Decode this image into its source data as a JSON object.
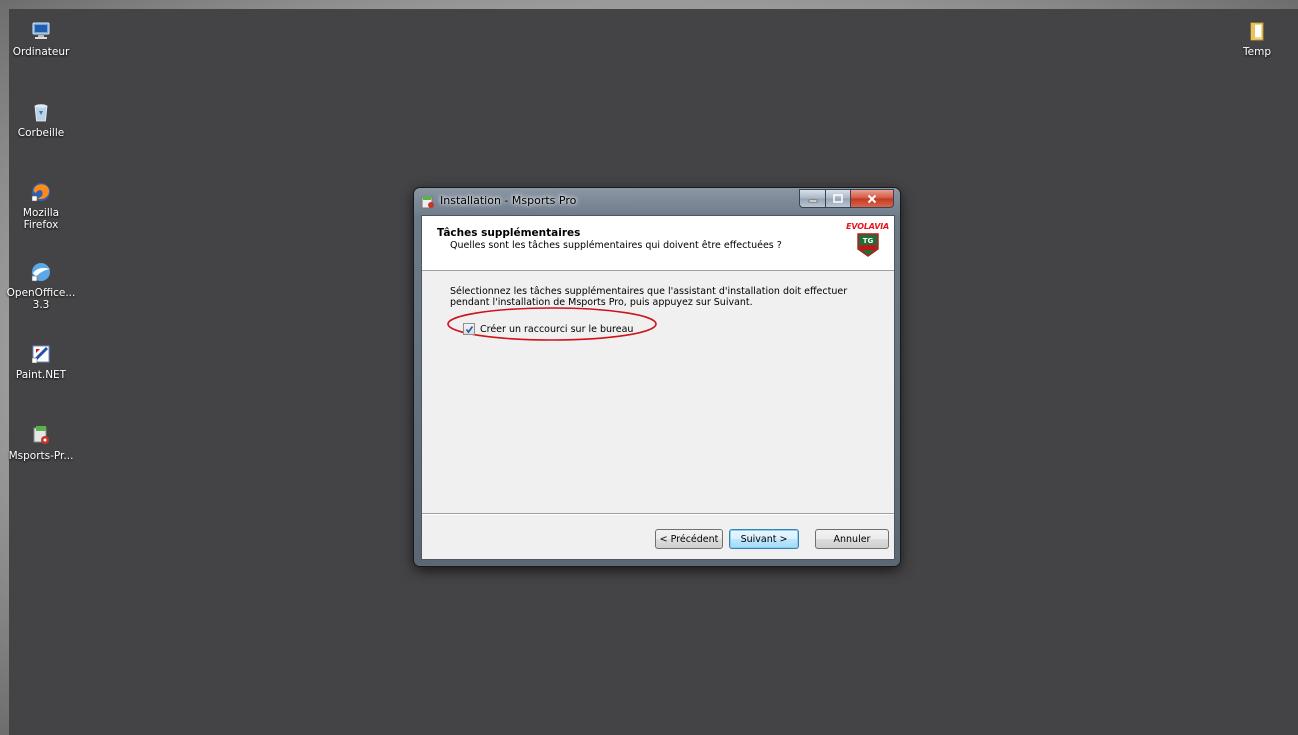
{
  "desktop": {
    "icons_left": [
      {
        "label": "Ordinateur",
        "icon": "computer-icon"
      },
      {
        "label": "Corbeille",
        "icon": "recycle-bin-icon"
      },
      {
        "label": "Mozilla\nFirefox",
        "icon": "firefox-icon"
      },
      {
        "label": "OpenOffice...\n3.3",
        "icon": "openoffice-icon"
      },
      {
        "label": "Paint.NET",
        "icon": "paintnet-icon"
      },
      {
        "label": "Msports-Pr...",
        "icon": "installer-icon"
      }
    ],
    "icon_right": {
      "label": "Temp",
      "icon": "folder-icon"
    }
  },
  "dialog": {
    "title": "Installation - Msports Pro",
    "header_title": "Tâches supplémentaires",
    "header_subtitle": "Quelles sont les tâches supplémentaires qui doivent être effectuées ?",
    "logo_text": "EVOLAVIA",
    "logo_badge": "TAG\nHEUER",
    "body_text": "Sélectionnez les tâches supplémentaires que l'assistant d'installation doit effectuer\npendant l'installation de Msports Pro, puis appuyez sur Suivant.",
    "checkbox_label": "Créer un raccourci sur le bureau",
    "checkbox_checked": true,
    "buttons": {
      "back": "< Précédent",
      "next": "Suivant >",
      "cancel": "Annuler"
    }
  },
  "colors": {
    "desktop": "#444446",
    "annotation": "#d0121b",
    "logo_red": "#e8141b"
  }
}
